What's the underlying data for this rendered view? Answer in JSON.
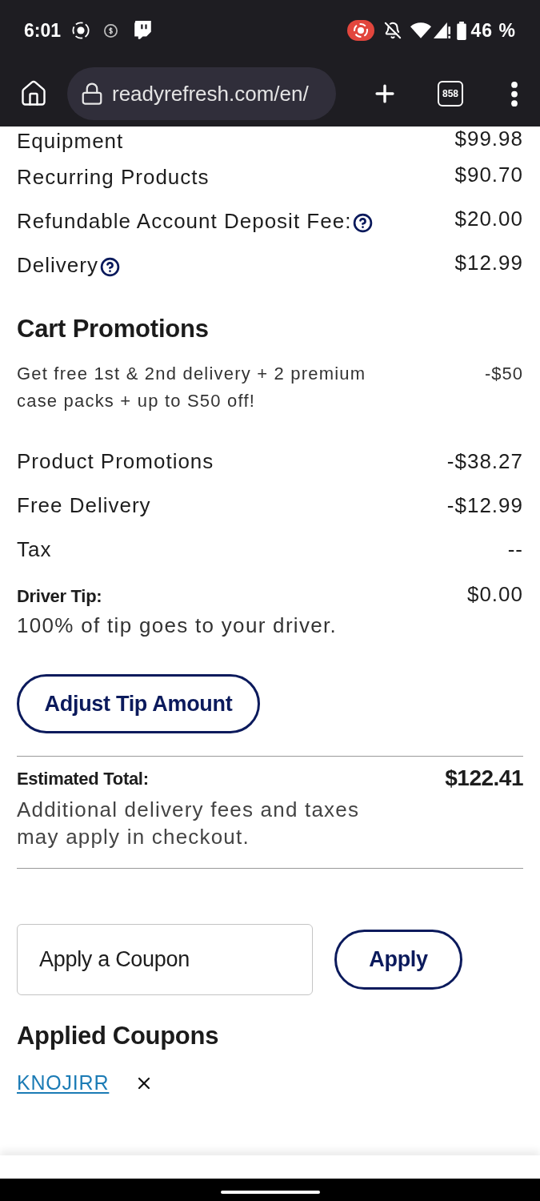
{
  "status_bar": {
    "time": "6:01",
    "battery": "46 %"
  },
  "browser_bar": {
    "url": "readyrefresh.com/en/",
    "tab_count": "858"
  },
  "summary_rows": [
    {
      "label": "Equipment",
      "value": "$99.98",
      "info": false
    },
    {
      "label": "Recurring Products",
      "value": "$90.70",
      "info": false
    },
    {
      "label": "Refundable Account Deposit Fee:",
      "value": "$20.00",
      "info": true
    },
    {
      "label": "Delivery",
      "value": "$12.99",
      "info": true
    }
  ],
  "promotions": {
    "title": "Cart Promotions",
    "offer": {
      "text": "Get free 1st & 2nd delivery + 2 premium case packs + up to S50 off!",
      "value": "-$50"
    }
  },
  "adjustment_rows": [
    {
      "label": "Product Promotions",
      "value": "-$38.27"
    },
    {
      "label": "Free Delivery",
      "value": "-$12.99"
    },
    {
      "label": "Tax",
      "value": "--"
    }
  ],
  "tip": {
    "label": "Driver Tip:",
    "value": "$0.00",
    "note": "100% of tip goes to your driver.",
    "button": "Adjust Tip Amount"
  },
  "total": {
    "label": "Estimated Total:",
    "value": "$122.41",
    "note": "Additional delivery fees and taxes may apply in checkout."
  },
  "coupon": {
    "placeholder": "Apply a Coupon",
    "button": "Apply"
  },
  "applied": {
    "title": "Applied Coupons",
    "coupons": [
      {
        "code": "KNOJIRR"
      }
    ]
  }
}
